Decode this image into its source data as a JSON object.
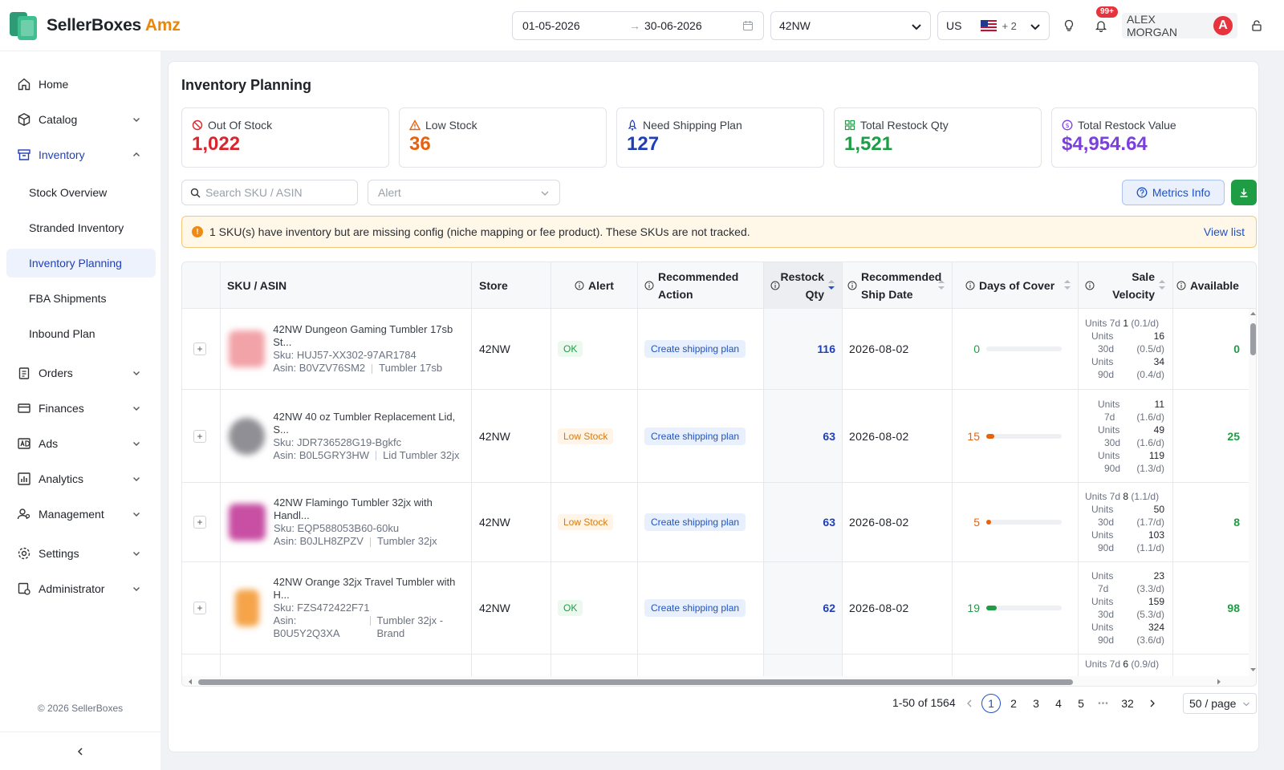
{
  "app": {
    "name": "SellerBoxes",
    "name_suffix": "Amz"
  },
  "header": {
    "date_from": "01-05-2026",
    "date_to": "30-06-2026",
    "date_separator": "→",
    "store_value": "42NW",
    "marketplace_value": "US",
    "marketplace_extra": "+ 2",
    "notification_count": "99+",
    "user_name": "ALEX MORGAN",
    "user_initial": "A"
  },
  "sidebar": {
    "items": [
      {
        "label": "Home"
      },
      {
        "label": "Catalog"
      },
      {
        "label": "Inventory"
      },
      {
        "label": "Orders"
      },
      {
        "label": "Finances"
      },
      {
        "label": "Ads"
      },
      {
        "label": "Analytics"
      },
      {
        "label": "Management"
      },
      {
        "label": "Settings"
      },
      {
        "label": "Administrator"
      }
    ],
    "inventory_sub": [
      {
        "label": "Stock Overview"
      },
      {
        "label": "Stranded Inventory"
      },
      {
        "label": "Inventory Planning"
      },
      {
        "label": "FBA Shipments"
      },
      {
        "label": "Inbound Plan"
      }
    ],
    "copyright": "© 2026 SellerBoxes"
  },
  "page": {
    "title": "Inventory Planning",
    "cards": [
      {
        "label": "Out Of Stock",
        "value": "1,022",
        "color": "#d9262e"
      },
      {
        "label": "Low Stock",
        "value": "36",
        "color": "#e8620c"
      },
      {
        "label": "Need Shipping Plan",
        "value": "127",
        "color": "#1f3fb8"
      },
      {
        "label": "Total Restock Qty",
        "value": "1,521",
        "color": "#1f9d45"
      },
      {
        "label": "Total Restock Value",
        "value": "$4,954.64",
        "color": "#7b3fe0"
      }
    ],
    "search_placeholder": "Search SKU / ASIN",
    "alert_placeholder": "Alert",
    "metrics_info": "Metrics Info",
    "warning_text": "1 SKU(s) have inventory but are missing config (niche mapping or fee product). These SKUs are not tracked.",
    "view_list": "View list"
  },
  "table": {
    "columns": {
      "sku": "SKU / ASIN",
      "store": "Store",
      "alert": "Alert",
      "action_l1": "Recommended",
      "action_l2": "Action",
      "restock_l1": "Restock",
      "restock_l2": "Qty",
      "ship_l1": "Recommended",
      "ship_l2": "Ship Date",
      "cover": "Days of Cover",
      "vel_l1": "Sale",
      "vel_l2": "Velocity",
      "avail": "Available"
    },
    "rows": [
      {
        "name": "42NW Dungeon Gaming Tumbler 17sb St...",
        "sku": "Sku: HUJ57-XX302-97AR1784",
        "asin": "Asin: B0VZV76SM2",
        "niche": "Tumbler 17sb",
        "store": "42NW",
        "alert": "OK",
        "action": "Create shipping plan",
        "restock": "116",
        "ship_date": "2026-08-02",
        "cover": "0",
        "cover_frac": 0.0,
        "cover_color": "#1f9d45",
        "v7": "1",
        "v7r": "(0.1/d)",
        "v30": "16",
        "v30r": "(0.5/d)",
        "v90": "34",
        "v90r": "(0.4/d)",
        "avail": "0",
        "thumb": "#f2a3a8"
      },
      {
        "name": "42NW 40 oz Tumbler Replacement Lid, S...",
        "sku": "Sku: JDR736528G19-Bgkfc",
        "asin": "Asin: B0L5GRY3HW",
        "niche": "Lid Tumbler 32jx",
        "store": "42NW",
        "alert": "Low Stock",
        "action": "Create shipping plan",
        "restock": "63",
        "ship_date": "2026-08-02",
        "cover": "15",
        "cover_frac": 0.11,
        "cover_color": "#e8620c",
        "v7": "11",
        "v7r": "(1.6/d)",
        "v30": "49",
        "v30r": "(1.6/d)",
        "v90": "119",
        "v90r": "(1.3/d)",
        "avail": "25",
        "thumb": "#8f8f95"
      },
      {
        "name": "42NW Flamingo Tumbler 32jx with Handl...",
        "sku": "Sku: EQP588053B60-60ku",
        "asin": "Asin: B0JLH8ZPZV",
        "niche": "Tumbler 32jx",
        "store": "42NW",
        "alert": "Low Stock",
        "action": "Create shipping plan",
        "restock": "63",
        "ship_date": "2026-08-02",
        "cover": "5",
        "cover_frac": 0.04,
        "cover_color": "#e8620c",
        "v7": "8",
        "v7r": "(1.1/d)",
        "v30": "50",
        "v30r": "(1.7/d)",
        "v90": "103",
        "v90r": "(1.1/d)",
        "avail": "8",
        "thumb": "#c84fa3"
      },
      {
        "name": "42NW Orange 32jx Travel Tumbler with H...",
        "sku": "Sku: FZS472422F71",
        "asin": "Asin:",
        "asin2": "B0U5Y2Q3XA",
        "niche": "Tumbler 32jx -",
        "niche2": "Brand",
        "store": "42NW",
        "alert": "OK",
        "action": "Create shipping plan",
        "restock": "62",
        "ship_date": "2026-08-02",
        "cover": "19",
        "cover_frac": 0.14,
        "cover_color": "#1f9d45",
        "v7": "23",
        "v7r": "(3.3/d)",
        "v30": "159",
        "v30r": "(5.3/d)",
        "v90": "324",
        "v90r": "(3.6/d)",
        "avail": "98",
        "thumb": "#f5a44a"
      }
    ],
    "partial_row": {
      "v7": "6",
      "v7r": "(0.9/d)"
    },
    "units7": "Units 7d",
    "units30": "30d",
    "units90": "90d",
    "units": "Units",
    "seven": "7d"
  },
  "pagination": {
    "range": "1-50 of 1564",
    "pages": [
      "1",
      "2",
      "3",
      "4",
      "5",
      "32"
    ],
    "ellipsis": "•••",
    "page_size": "50 / page"
  }
}
